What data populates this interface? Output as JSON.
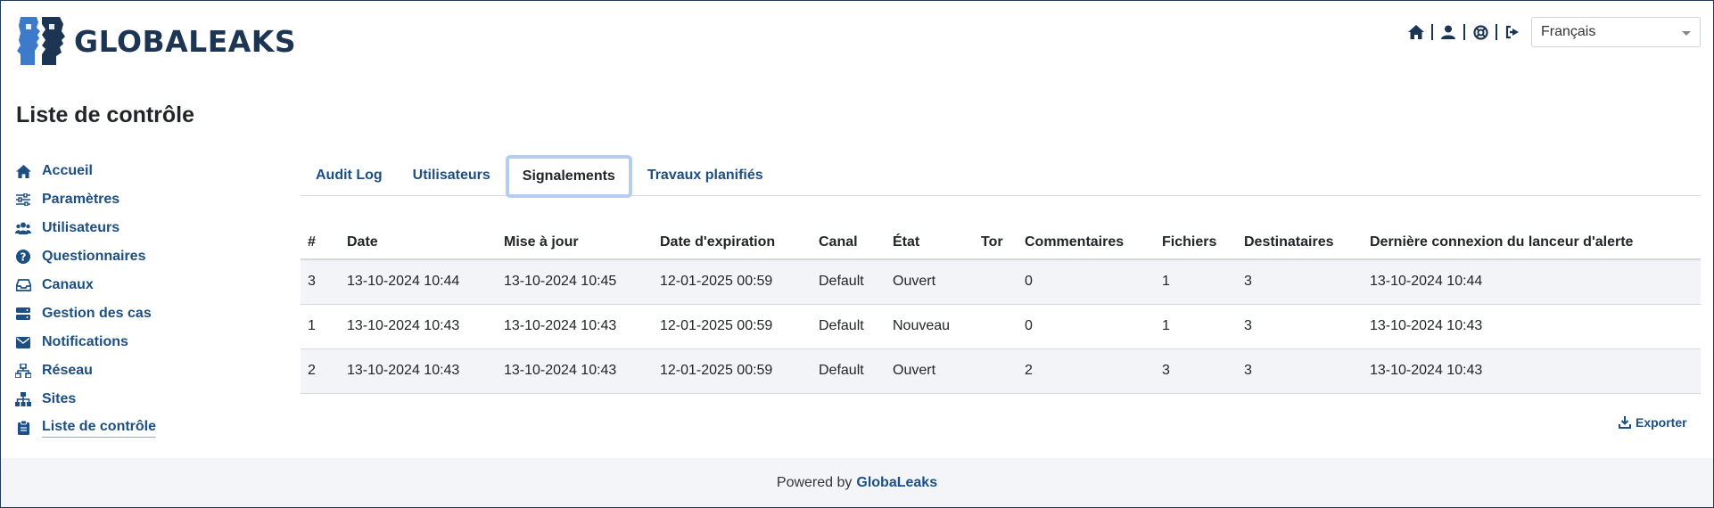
{
  "header": {
    "logo_text": "GLOBALEAKS",
    "icons": [
      "home-icon",
      "user-icon",
      "support-icon",
      "logout-icon"
    ],
    "language": "Français"
  },
  "page_title": "Liste de contrôle",
  "sidebar": {
    "items": [
      {
        "label": "Accueil",
        "icon": "home-icon"
      },
      {
        "label": "Paramètres",
        "icon": "sliders-icon"
      },
      {
        "label": "Utilisateurs",
        "icon": "users-icon"
      },
      {
        "label": "Questionnaires",
        "icon": "question-circle-icon"
      },
      {
        "label": "Canaux",
        "icon": "inbox-icon"
      },
      {
        "label": "Gestion des cas",
        "icon": "server-icon"
      },
      {
        "label": "Notifications",
        "icon": "envelope-icon"
      },
      {
        "label": "Réseau",
        "icon": "network-icon"
      },
      {
        "label": "Sites",
        "icon": "sitemap-icon"
      },
      {
        "label": "Liste de contrôle",
        "icon": "clipboard-icon",
        "active": true
      }
    ]
  },
  "tabs": [
    {
      "label": "Audit Log",
      "active": false
    },
    {
      "label": "Utilisateurs",
      "active": false
    },
    {
      "label": "Signalements",
      "active": true
    },
    {
      "label": "Travaux planifiés",
      "active": false
    }
  ],
  "table": {
    "columns": [
      "#",
      "Date",
      "Mise à jour",
      "Date d'expiration",
      "Canal",
      "État",
      "Tor",
      "Commentaires",
      "Fichiers",
      "Destinataires",
      "Dernière connexion du lanceur d'alerte"
    ],
    "rows": [
      [
        "3",
        "13-10-2024 10:44",
        "13-10-2024 10:45",
        "12-01-2025 00:59",
        "Default",
        "Ouvert",
        "",
        "0",
        "1",
        "3",
        "13-10-2024 10:44"
      ],
      [
        "1",
        "13-10-2024 10:43",
        "13-10-2024 10:43",
        "12-01-2025 00:59",
        "Default",
        "Nouveau",
        "",
        "0",
        "1",
        "3",
        "13-10-2024 10:43"
      ],
      [
        "2",
        "13-10-2024 10:43",
        "13-10-2024 10:43",
        "12-01-2025 00:59",
        "Default",
        "Ouvert",
        "",
        "2",
        "3",
        "3",
        "13-10-2024 10:43"
      ]
    ]
  },
  "export_label": "Exporter",
  "footer": {
    "prefix": "Powered by",
    "brand": "GlobaLeaks"
  },
  "colors": {
    "brand": "#1c3553",
    "link": "#1c4f84",
    "active_tab_border": "#b6cdf2",
    "row_stripe": "#f2f4f7",
    "footer_bg": "#f3f5f8"
  }
}
